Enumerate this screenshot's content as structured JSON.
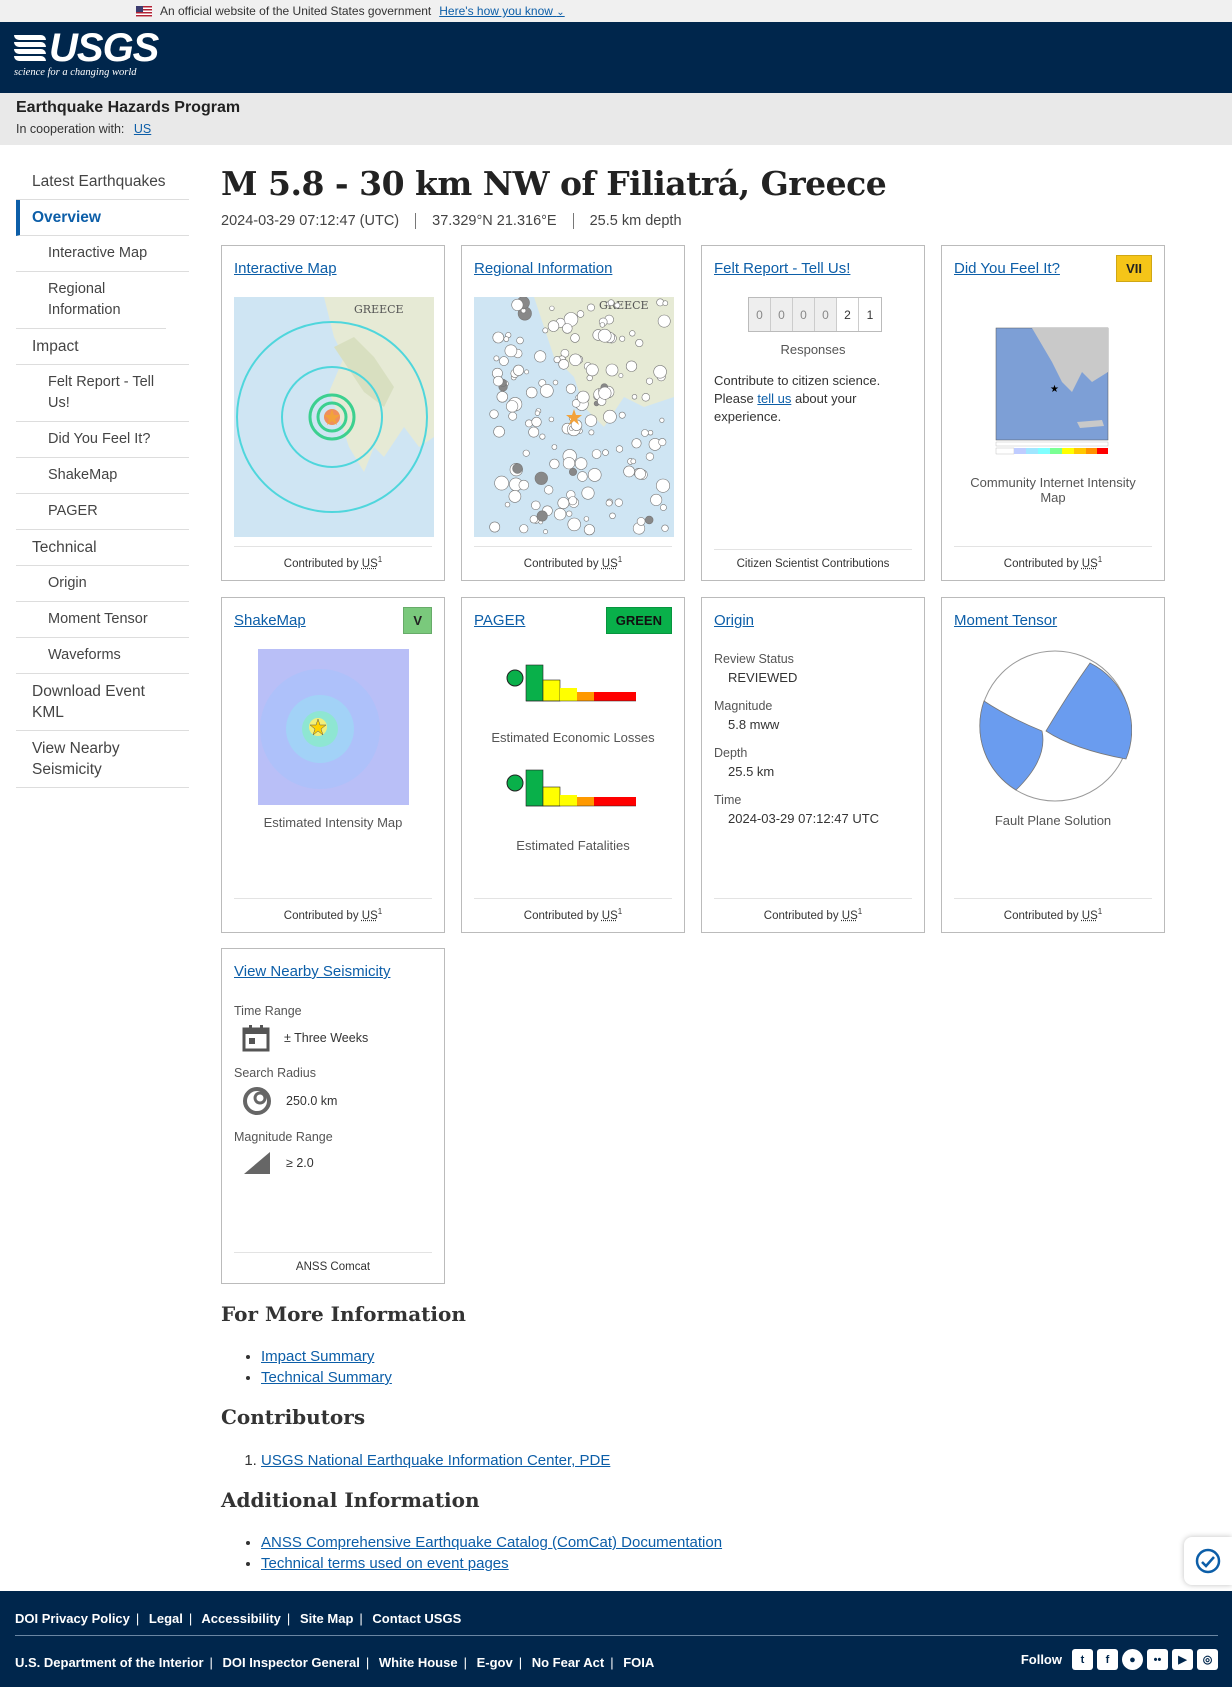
{
  "gov_banner": {
    "text": "An official website of the United States government",
    "link": "Here's how you know"
  },
  "header": {
    "logo_text": "USGS",
    "tagline": "science for a changing world"
  },
  "program": {
    "title": "Earthquake Hazards Program",
    "coop_label": "In cooperation with:",
    "coop_link": "US"
  },
  "sidebar": {
    "items": [
      {
        "label": "Latest Earthquakes"
      },
      {
        "label": "Overview"
      },
      {
        "label": "Interactive Map"
      },
      {
        "label": "Regional Information"
      },
      {
        "label": "Impact"
      },
      {
        "label": "Felt Report - Tell Us!"
      },
      {
        "label": "Did You Feel It?"
      },
      {
        "label": "ShakeMap"
      },
      {
        "label": "PAGER"
      },
      {
        "label": "Technical"
      },
      {
        "label": "Origin"
      },
      {
        "label": "Moment Tensor"
      },
      {
        "label": "Waveforms"
      },
      {
        "label": "Download Event KML"
      },
      {
        "label": "View Nearby Seismicity"
      }
    ]
  },
  "event": {
    "title": "M 5.8 - 30 km NW of Filiatrá, Greece",
    "time": "2024-03-29 07:12:47 (UTC)",
    "location": "37.329°N 21.316°E",
    "depth": "25.5 km depth"
  },
  "cards": {
    "interactive_map": {
      "title": "Interactive Map",
      "map_label": "GREECE",
      "footer_prefix": "Contributed by",
      "footer_net": "US",
      "footer_ref": "1"
    },
    "regional": {
      "title": "Regional Information",
      "map_label": "GREECE",
      "footer_prefix": "Contributed by",
      "footer_net": "US",
      "footer_ref": "1"
    },
    "felt_report": {
      "title": "Felt Report - Tell Us!",
      "digits": [
        "0",
        "0",
        "0",
        "0",
        "2",
        "1"
      ],
      "responses_label": "Responses",
      "text_before": "Contribute to citizen science. Please",
      "link": "tell us",
      "text_after": "about your experience.",
      "footer": "Citizen Scientist Contributions"
    },
    "dyfi": {
      "title": "Did You Feel It?",
      "badge": "VII",
      "badge_color": "#f5c518",
      "caption": "Community Internet Intensity Map",
      "footer_prefix": "Contributed by",
      "footer_net": "US",
      "footer_ref": "1"
    },
    "shakemap": {
      "title": "ShakeMap",
      "badge": "V",
      "badge_color": "#7ac97c",
      "caption": "Estimated Intensity Map",
      "footer_prefix": "Contributed by",
      "footer_net": "US",
      "footer_ref": "1"
    },
    "pager": {
      "title": "PAGER",
      "badge": "GREEN",
      "badge_color": "#09b04a",
      "caption_losses": "Estimated Economic Losses",
      "caption_fatalities": "Estimated Fatalities",
      "footer_prefix": "Contributed by",
      "footer_net": "US",
      "footer_ref": "1"
    },
    "origin": {
      "title": "Origin",
      "rows": [
        {
          "label": "Review Status",
          "value": "REVIEWED"
        },
        {
          "label": "Magnitude",
          "value": "5.8 mww"
        },
        {
          "label": "Depth",
          "value": "25.5 km"
        },
        {
          "label": "Time",
          "value": "2024-03-29 07:12:47 UTC"
        }
      ],
      "footer_prefix": "Contributed by",
      "footer_net": "US",
      "footer_ref": "1"
    },
    "moment_tensor": {
      "title": "Moment Tensor",
      "caption": "Fault Plane Solution",
      "footer_prefix": "Contributed by",
      "footer_net": "US",
      "footer_ref": "1"
    },
    "nearby": {
      "title": "View Nearby Seismicity",
      "time_label": "Time Range",
      "time_value": "± Three Weeks",
      "radius_label": "Search Radius",
      "radius_value": "250.0 km",
      "mag_label": "Magnitude Range",
      "mag_value": "≥ 2.0",
      "footer": "ANSS Comcat"
    }
  },
  "more_info": {
    "heading": "For More Information",
    "links": [
      "Impact Summary",
      "Technical Summary"
    ]
  },
  "contributors": {
    "heading": "Contributors",
    "items": [
      "USGS National Earthquake Information Center, PDE"
    ]
  },
  "additional": {
    "heading": "Additional Information",
    "links": [
      "ANSS Comprehensive Earthquake Catalog (ComCat) Documentation",
      "Technical terms used on event pages"
    ]
  },
  "footer": {
    "row1": [
      "DOI Privacy Policy",
      "Legal",
      "Accessibility",
      "Site Map",
      "Contact USGS"
    ],
    "row2": [
      "U.S. Department of the Interior",
      "DOI Inspector General",
      "White House",
      "E-gov",
      "No Fear Act",
      "FOIA"
    ],
    "follow_label": "Follow",
    "social_icons": [
      "twitter-icon",
      "facebook-icon",
      "github-icon",
      "flickr-icon",
      "youtube-icon",
      "instagram-icon"
    ]
  },
  "colors": {
    "header_bg": "#00264c",
    "link": "#0c5ea8",
    "pager_green": "#09b04a"
  }
}
